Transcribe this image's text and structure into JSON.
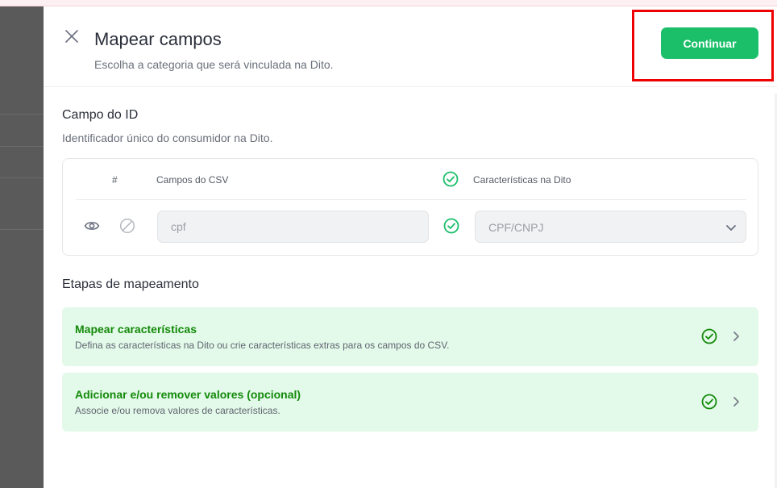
{
  "modal": {
    "title": "Mapear campos",
    "subtitle": "Escolha a categoria que será vinculada na Dito.",
    "continue_label": "Continuar",
    "accent_color": "#1bbf6a",
    "highlight_color": "#ee0000"
  },
  "id_section": {
    "title": "Campo do ID",
    "description": "Identificador único do consumidor na Dito.",
    "columns": {
      "index": "#",
      "csv": "Campos do CSV",
      "dito": "Características na Dito"
    },
    "row": {
      "csv_value": "cpf",
      "dito_value": "CPF/CNPJ"
    }
  },
  "steps_section": {
    "title": "Etapas de mapeamento",
    "steps": [
      {
        "title": "Mapear características",
        "description": "Defina as características na Dito ou crie características extras para os campos do CSV.",
        "status_icon": "check-circle-icon"
      },
      {
        "title": "Adicionar e/ou remover valores (opcional)",
        "description": "Associe e/ou remova valores de características.",
        "status_icon": "check-circle-icon"
      }
    ]
  }
}
